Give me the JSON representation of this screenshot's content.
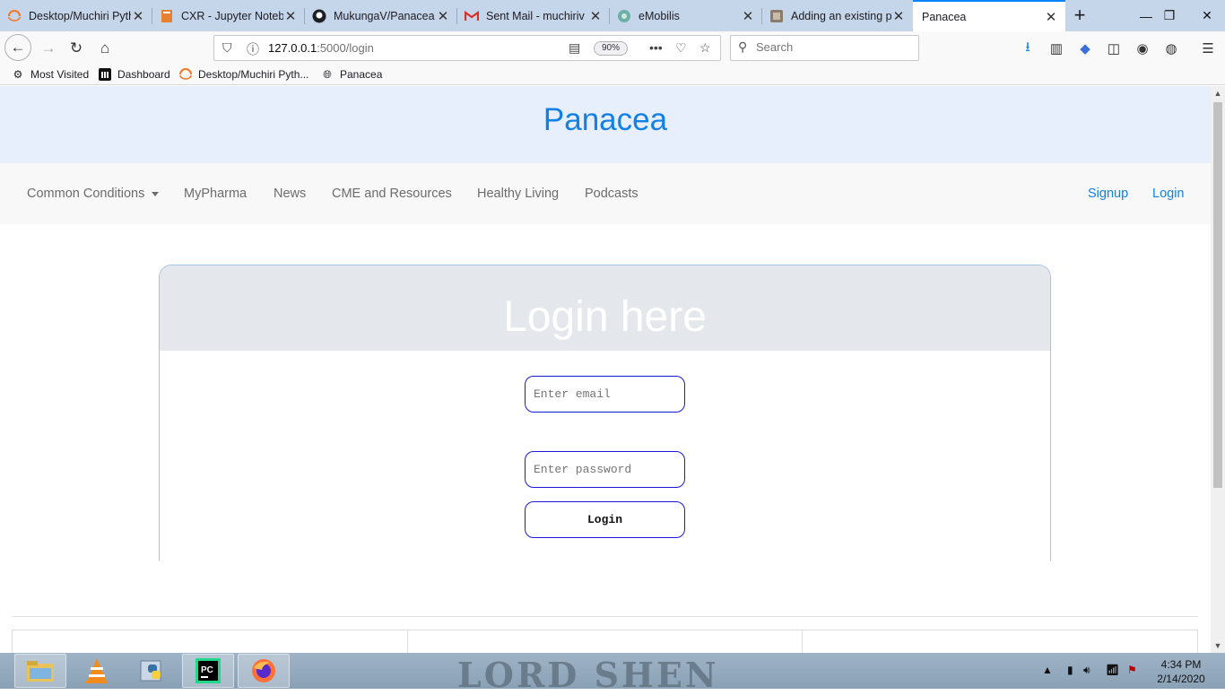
{
  "browser": {
    "tabs": [
      {
        "title": "Desktop/Muchiri Pyth",
        "icon": "jupyter-icon"
      },
      {
        "title": "CXR - Jupyter Noteb",
        "icon": "notebook-icon"
      },
      {
        "title": "MukungaV/Panacea",
        "icon": "github-icon"
      },
      {
        "title": "Sent Mail - muchiriv",
        "icon": "gmail-icon"
      },
      {
        "title": "eMobilis",
        "icon": "globe-icon"
      },
      {
        "title": "Adding an existing p",
        "icon": "page-icon"
      },
      {
        "title": "Panacea",
        "icon": ""
      }
    ],
    "url_host": "127.0.0.1",
    "url_rest": ":5000/login",
    "zoom": "90%",
    "search_placeholder": "Search",
    "bookmarks": [
      {
        "label": "Most Visited"
      },
      {
        "label": "Dashboard"
      },
      {
        "label": "Desktop/Muchiri Pyth..."
      },
      {
        "label": "Panacea"
      }
    ]
  },
  "site": {
    "brand": "Panacea",
    "nav": {
      "common_conditions": "Common Conditions",
      "mypharma": "MyPharma",
      "news": "News",
      "cme": "CME and Resources",
      "healthy_living": "Healthy Living",
      "podcasts": "Podcasts",
      "signup": "Signup",
      "login": "Login"
    },
    "login": {
      "heading": "Login here",
      "email_placeholder": "Enter email",
      "password_placeholder": "Enter password",
      "button": "Login"
    }
  },
  "taskbar": {
    "wallpaper_text": "LORD SHEN",
    "time": "4:34 PM",
    "date": "2/14/2020"
  },
  "colors": {
    "brand_blue": "#1380e6",
    "header_bg": "#e7effd",
    "input_border": "#1b1bd6",
    "tab_accent": "#0a84ff"
  }
}
